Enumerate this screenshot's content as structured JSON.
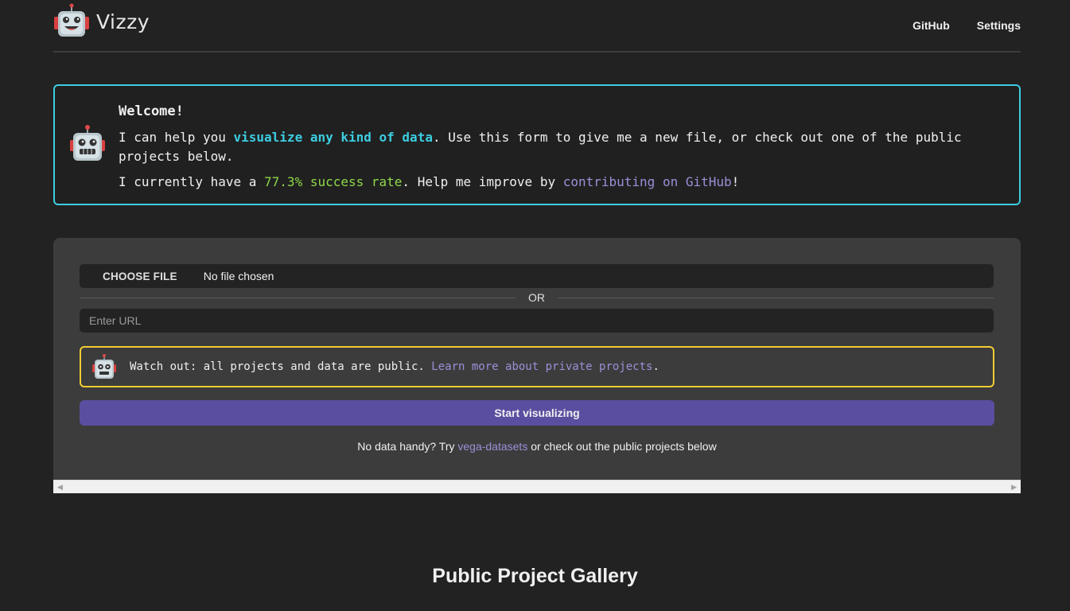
{
  "header": {
    "logo_text": "Vizzy",
    "logo_icon": "robot-icon",
    "nav": [
      {
        "label": "GitHub"
      },
      {
        "label": "Settings"
      }
    ]
  },
  "welcome": {
    "title": "Welcome!",
    "line1_pre": "I can help you ",
    "line1_highlight": "visualize any kind of data",
    "line1_post": ". Use this form to give me a new file, or check out one of the public projects below.",
    "line2_pre": "I currently have a ",
    "line2_rate": "77.3% success rate",
    "line2_mid": ". Help me improve by ",
    "line2_link": "contributing on GitHub",
    "line2_post": "!",
    "accent_color": "#3ccde0"
  },
  "form": {
    "choose_file_label": "CHOOSE FILE",
    "file_status": "No file chosen",
    "or_label": "OR",
    "url_placeholder": "Enter URL",
    "warning_pre": "Watch out: all projects and data are public. ",
    "warning_link": "Learn more about private projects",
    "warning_post": ".",
    "warning_color": "#f2cd31",
    "start_button": "Start visualizing",
    "start_button_color": "#5a4ea0",
    "hint_pre": "No data handy? Try ",
    "hint_link": "vega-datasets",
    "hint_post": " or check out the public projects below"
  },
  "gallery": {
    "title": "Public Project Gallery"
  }
}
